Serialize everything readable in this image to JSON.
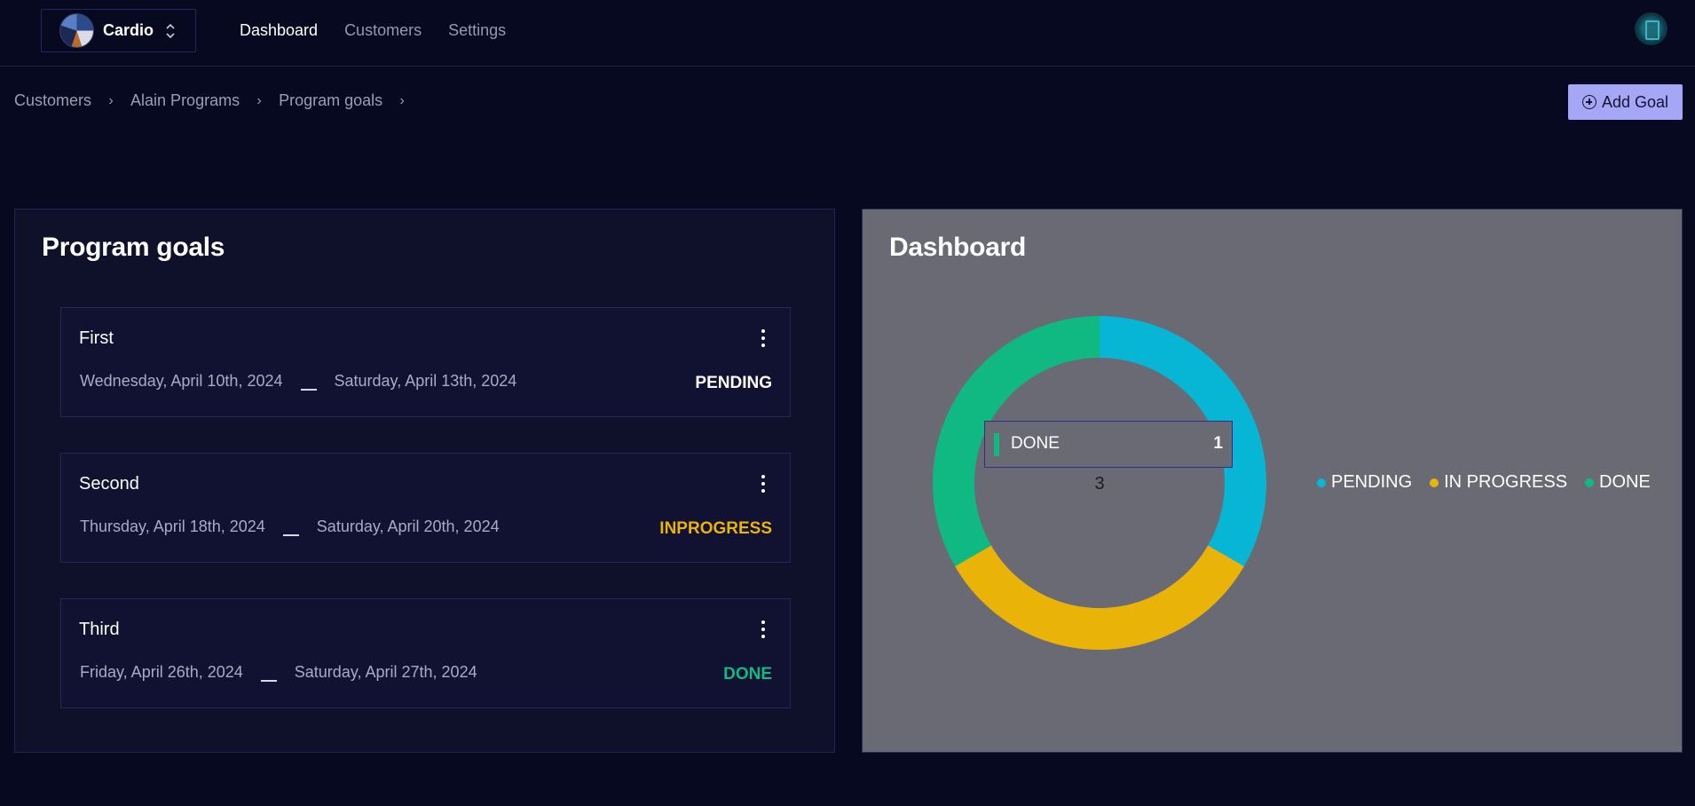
{
  "header": {
    "team": {
      "name": "Cardio"
    },
    "nav": [
      {
        "label": "Dashboard",
        "active": true
      },
      {
        "label": "Customers",
        "active": false
      },
      {
        "label": "Settings",
        "active": false
      }
    ]
  },
  "breadcrumb": [
    "Customers",
    "Alain Programs",
    "Program goals"
  ],
  "actions": {
    "add_goal_label": "Add Goal"
  },
  "goals": {
    "title": "Program goals",
    "items": [
      {
        "title": "First",
        "start": "Wednesday, April 10th, 2024",
        "end": "Saturday, April 13th, 2024",
        "status": "PENDING",
        "status_color": "#ffffff"
      },
      {
        "title": "Second",
        "start": "Thursday, April 18th, 2024",
        "end": "Saturday, April 20th, 2024",
        "status": "INPROGRESS",
        "status_color": "#eab308"
      },
      {
        "title": "Third",
        "start": "Friday, April 26th, 2024",
        "end": "Saturday, April 27th, 2024",
        "status": "DONE",
        "status_color": "#10b981"
      }
    ]
  },
  "dashboard": {
    "title": "Dashboard",
    "tooltip": {
      "label": "DONE",
      "value": "1",
      "color": "#10b981"
    },
    "center_total": "3"
  },
  "chart_data": {
    "type": "pie",
    "donut": true,
    "categories": [
      "PENDING",
      "IN PROGRESS",
      "DONE"
    ],
    "values": [
      1,
      1,
      1
    ],
    "colors": [
      "#06b6d4",
      "#eab308",
      "#10b981"
    ],
    "total": 3,
    "legend": "right"
  },
  "colors": {
    "background": "#070920",
    "panel": "#0f1029",
    "accent_button": "#a5a6f5",
    "chart_panel": "#6a6a74"
  },
  "icons": {
    "team_switch": "chevron-up-down-icon",
    "add_goal": "plus-circle-icon",
    "breadcrumb_sep": "chevron-right-icon",
    "card_menu": "more-vertical-icon"
  }
}
